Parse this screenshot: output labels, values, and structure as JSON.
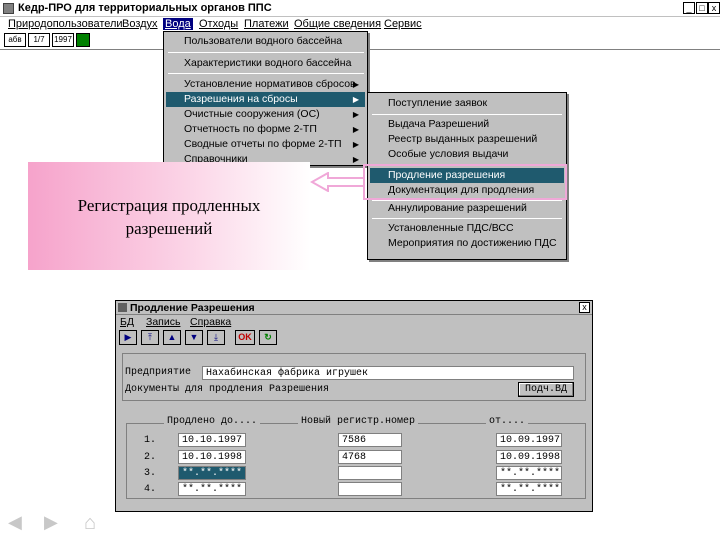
{
  "app": {
    "title": "Кедр-ПРО для территориальных органов ППС"
  },
  "window_buttons": [
    "_",
    "□",
    "x"
  ],
  "menubar": {
    "items": [
      "Природопользователи",
      "Воздух",
      "Вода",
      "Отходы",
      "Платежи",
      "Общие сведения",
      "Сервис"
    ],
    "active": "Вода"
  },
  "toolbar": {
    "buttons": [
      "абв",
      "1/7",
      "1997",
      ""
    ]
  },
  "menu_voda": {
    "items": [
      "Пользователи водного бассейна",
      "Характеристики водного бассейна",
      "Установление нормативов сбросов",
      "Разрешения на сбросы",
      "Очистные сооружения (ОС)",
      "Отчетность по форме 2-ТП",
      "Сводные отчеты по форме 2-ТП",
      "Справочники"
    ]
  },
  "menu_razresheniya": {
    "items": [
      "Поступление заявок",
      "Выдача Разрешений",
      "Реестр выданных разрешений",
      "Особые условия выдачи",
      "Продление разрешения",
      "Документация для продления",
      "Аннулирование разрешений",
      "Установленные ПДС/ВСС",
      "Мероприятия по достижению ПДС"
    ]
  },
  "callout": {
    "line1": "Регистрация продленных",
    "line2": "разрешений"
  },
  "dialog": {
    "title": "Продление Разрешения",
    "menu": [
      "БД",
      "Запись",
      "Справка"
    ],
    "tools": [
      "▶",
      "⤒",
      "▲",
      "▼",
      "⤓",
      "OK",
      "↻"
    ],
    "enterprise_label": "Предприятие",
    "enterprise_value": "Нахабинская фабрика игрушек",
    "docs_label": "Документы для продления Разрешения",
    "docs_button": "Подч.ВД",
    "col_extended": "Продлено до....",
    "col_regnum": "Новый регистр.номер",
    "col_from": "от....",
    "rows": [
      {
        "n": "1.",
        "date": "10.10.1997",
        "reg": "7586",
        "from": "10.09.1997"
      },
      {
        "n": "2.",
        "date": "10.10.1998",
        "reg": "4768",
        "from": "10.09.1998"
      },
      {
        "n": "3.",
        "date": "**.**.****",
        "reg": "",
        "from": "**.**.****"
      },
      {
        "n": "4.",
        "date": "**.**.****",
        "reg": "",
        "from": "**.**.****"
      }
    ]
  },
  "nav": {
    "back": "◀",
    "forward": "▶",
    "home": "⌂"
  },
  "colors": {
    "menu_bg": "#c0c0c0",
    "highlight": "#1f5a6e",
    "callout_pink": "#f6a3cb",
    "box_pink": "#f0a8d8"
  }
}
